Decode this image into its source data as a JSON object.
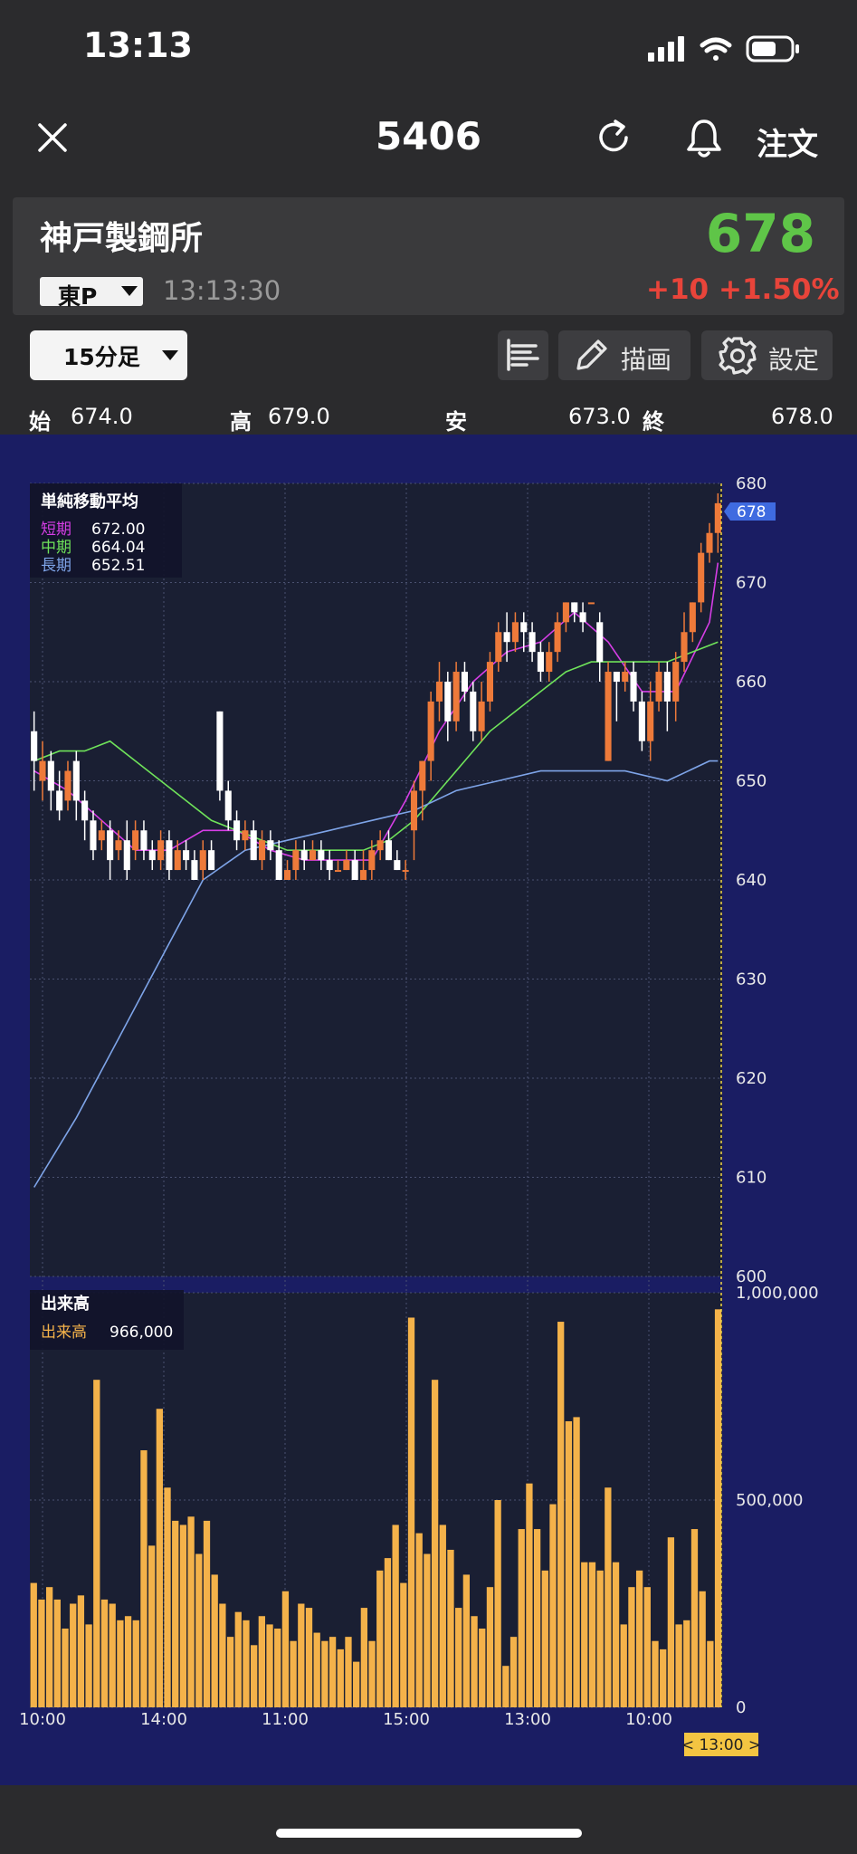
{
  "status_bar": {
    "time": "13:13"
  },
  "nav": {
    "ticker": "5406",
    "order_label": "注文"
  },
  "quote": {
    "name": "神戸製鋼所",
    "market": "東P",
    "time": "13:13:30",
    "price": "678",
    "change_abs": "+10",
    "change_pct": "+1.50%",
    "price_color": "#5fc548",
    "change_color": "#e8443a"
  },
  "toolbar": {
    "period": "15分足",
    "draw_label": "描画",
    "settings_label": "設定"
  },
  "ohlc": {
    "open_label": "始",
    "open": "674.0",
    "high_label": "高",
    "high": "679.0",
    "low_label": "安",
    "low": "673.0",
    "close_label": "終",
    "close": "678.0"
  },
  "legend": {
    "title": "単純移動平均",
    "short_label": "短期",
    "short_value": "672.00",
    "mid_label": "中期",
    "mid_value": "664.04",
    "long_label": "長期",
    "long_value": "652.51",
    "colors": {
      "short": "#d63ee6",
      "mid": "#6fe35a",
      "long": "#7ea4e8",
      "up": "#ee7a3a",
      "down": "#ffffff",
      "volume": "#f4b24a",
      "bg": "#1a1f33",
      "frame": "#1a1d63"
    }
  },
  "volume_legend": {
    "title": "出来高",
    "label": "出来高",
    "value": "966,000"
  },
  "chart_data": [
    {
      "type": "candlestick",
      "title": "単純移動平均",
      "ylim": [
        600,
        680
      ],
      "y_ticks": [
        "680",
        "670",
        "660",
        "650",
        "640",
        "630",
        "620",
        "610",
        "600"
      ],
      "current_price_tag": "678",
      "candles": [
        [
          655,
          652,
          657,
          649
        ],
        [
          650,
          652,
          654,
          648
        ],
        [
          652,
          649,
          653,
          647
        ],
        [
          649,
          647,
          651,
          646
        ],
        [
          648,
          651,
          652,
          647
        ],
        [
          652,
          648,
          653,
          646
        ],
        [
          648,
          646,
          649,
          644
        ],
        [
          646,
          643,
          647,
          642
        ],
        [
          644,
          645,
          646,
          643
        ],
        [
          645,
          642,
          646,
          640
        ],
        [
          643,
          644,
          645,
          642
        ],
        [
          644,
          641,
          646,
          640
        ],
        [
          643,
          645,
          646,
          642
        ],
        [
          645,
          643,
          646,
          642
        ],
        [
          643,
          642,
          644,
          641
        ],
        [
          642,
          644,
          645,
          641
        ],
        [
          644,
          641,
          645,
          640
        ],
        [
          641,
          643,
          644,
          641
        ],
        [
          643,
          642,
          644,
          641
        ],
        [
          642,
          640,
          643,
          640
        ],
        [
          641,
          643,
          644,
          640
        ],
        [
          643,
          641,
          644,
          641
        ],
        [
          657,
          649,
          657,
          648
        ],
        [
          649,
          646,
          650,
          645
        ],
        [
          646,
          644,
          647,
          643
        ],
        [
          644,
          645,
          646,
          643
        ],
        [
          645,
          642,
          646,
          642
        ],
        [
          642,
          644,
          645,
          641
        ],
        [
          644,
          643,
          645,
          642
        ],
        [
          643,
          640,
          644,
          640
        ],
        [
          640,
          641,
          642,
          640
        ],
        [
          641,
          643,
          644,
          640
        ],
        [
          643,
          642,
          644,
          641
        ],
        [
          642,
          643,
          644,
          642
        ],
        [
          643,
          642,
          644,
          641
        ],
        [
          642,
          641,
          643,
          640
        ],
        [
          641,
          641,
          642,
          641
        ],
        [
          641,
          642,
          643,
          641
        ],
        [
          642,
          640,
          643,
          640
        ],
        [
          640,
          641,
          643,
          640
        ],
        [
          641,
          643,
          644,
          640
        ],
        [
          643,
          644,
          645,
          642
        ],
        [
          644,
          642,
          645,
          642
        ],
        [
          642,
          641,
          643,
          641
        ],
        [
          641,
          641,
          642,
          640
        ],
        [
          645,
          649,
          650,
          642
        ],
        [
          649,
          652,
          652,
          646
        ],
        [
          652,
          658,
          659,
          650
        ],
        [
          658,
          660,
          662,
          656
        ],
        [
          660,
          656,
          661,
          654
        ],
        [
          656,
          661,
          662,
          655
        ],
        [
          661,
          659,
          662,
          658
        ],
        [
          659,
          655,
          660,
          654
        ],
        [
          655,
          658,
          660,
          654
        ],
        [
          658,
          662,
          663,
          657
        ],
        [
          662,
          665,
          666,
          661
        ],
        [
          665,
          664,
          667,
          662
        ],
        [
          664,
          666,
          667,
          663
        ],
        [
          666,
          665,
          667,
          663
        ],
        [
          665,
          663,
          666,
          662
        ],
        [
          663,
          661,
          664,
          660
        ],
        [
          661,
          663,
          664,
          660
        ],
        [
          663,
          666,
          667,
          662
        ],
        [
          666,
          668,
          668,
          665
        ],
        [
          668,
          667,
          668,
          666
        ],
        [
          667,
          666,
          668,
          665
        ],
        [
          668,
          668,
          668,
          668
        ],
        [
          666,
          662,
          667,
          660
        ],
        [
          652,
          661,
          662,
          652
        ],
        [
          661,
          660,
          661,
          656
        ],
        [
          660,
          661,
          662,
          659
        ],
        [
          661,
          658,
          662,
          657
        ],
        [
          658,
          654,
          659,
          653
        ],
        [
          654,
          658,
          660,
          652
        ],
        [
          658,
          661,
          662,
          657
        ],
        [
          661,
          658,
          662,
          655
        ],
        [
          658,
          662,
          663,
          656
        ],
        [
          662,
          665,
          667,
          661
        ],
        [
          665,
          668,
          668,
          664
        ],
        [
          668,
          673,
          674,
          667
        ],
        [
          673,
          675,
          676,
          672
        ],
        [
          675,
          678,
          679,
          673
        ]
      ],
      "series": [
        {
          "name": "短期",
          "x": [
            0,
            4,
            8,
            12,
            16,
            20,
            24,
            28,
            32,
            36,
            40,
            44,
            48,
            52,
            56,
            60,
            64,
            68,
            72,
            76,
            80,
            81
          ],
          "values": [
            651,
            649,
            646,
            643,
            643,
            645,
            645,
            643,
            642,
            642,
            642,
            648,
            655,
            660,
            663,
            664,
            667,
            664,
            659,
            659,
            666,
            672
          ]
        },
        {
          "name": "中期",
          "x": [
            0,
            3,
            6,
            9,
            12,
            15,
            18,
            21,
            24,
            27,
            30,
            33,
            36,
            39,
            42,
            45,
            48,
            51,
            54,
            57,
            60,
            63,
            66,
            69,
            72,
            75,
            78,
            81
          ],
          "values": [
            652,
            653,
            653,
            654,
            652,
            650,
            648,
            646,
            645,
            644,
            643,
            643,
            643,
            643,
            644,
            646,
            649,
            652,
            655,
            657,
            659,
            661,
            662,
            662,
            662,
            662,
            663,
            664
          ]
        },
        {
          "name": "長期",
          "x": [
            0,
            5,
            10,
            15,
            20,
            25,
            30,
            35,
            40,
            45,
            50,
            55,
            60,
            65,
            70,
            75,
            80,
            81
          ],
          "values": [
            609,
            616,
            624,
            632,
            640,
            643,
            644,
            645,
            646,
            647,
            649,
            650,
            651,
            651,
            651,
            650,
            652,
            652
          ]
        }
      ]
    },
    {
      "type": "bar",
      "title": "出来高",
      "ylim": [
        0,
        1000000
      ],
      "y_ticks": [
        "1,000,000",
        "500,000",
        "0"
      ],
      "x_ticks": [
        "10:00",
        "14:00",
        "11:00",
        "15:00",
        "13:00",
        "10:00"
      ],
      "cursor_label": "< 13:00 >",
      "values": [
        300000,
        260000,
        290000,
        260000,
        190000,
        250000,
        270000,
        200000,
        790000,
        260000,
        250000,
        210000,
        220000,
        210000,
        620000,
        390000,
        720000,
        530000,
        450000,
        440000,
        460000,
        370000,
        450000,
        320000,
        250000,
        170000,
        230000,
        210000,
        150000,
        220000,
        200000,
        190000,
        280000,
        160000,
        250000,
        240000,
        180000,
        160000,
        170000,
        140000,
        170000,
        110000,
        240000,
        160000,
        330000,
        360000,
        440000,
        300000,
        940000,
        420000,
        370000,
        790000,
        440000,
        380000,
        240000,
        320000,
        220000,
        190000,
        290000,
        500000,
        100000,
        170000,
        430000,
        540000,
        430000,
        330000,
        490000,
        930000,
        690000,
        700000,
        350000,
        350000,
        330000,
        530000,
        350000,
        200000,
        290000,
        330000,
        290000,
        160000,
        140000,
        410000,
        200000,
        210000,
        430000,
        280000,
        160000,
        960000
      ]
    }
  ]
}
